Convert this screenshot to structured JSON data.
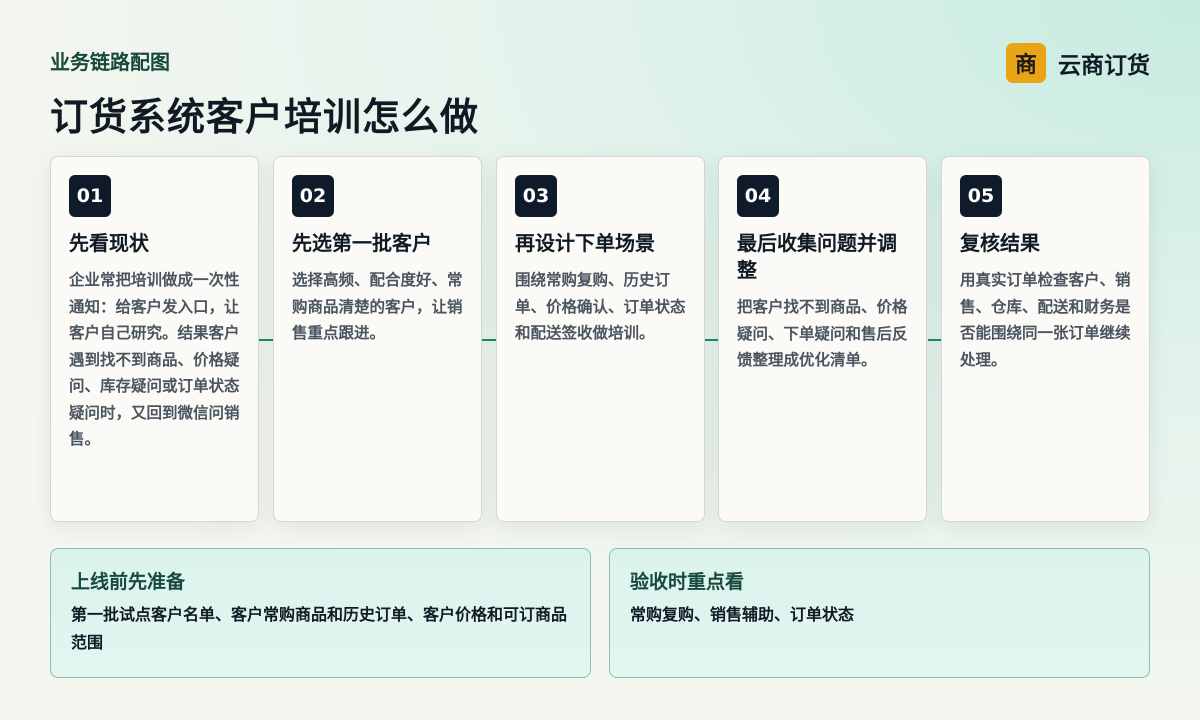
{
  "header": {
    "subtitle": "业务链路配图",
    "title": "订货系统客户培训怎么做"
  },
  "brand": {
    "logo_char": "商",
    "name": "云商订货",
    "logo_color": "#e9a515"
  },
  "steps": [
    {
      "num": "01",
      "title": "先看现状",
      "body": "企业常把培训做成一次性通知：给客户发入口，让客户自己研究。结果客户遇到找不到商品、价格疑问、库存疑问或订单状态疑问时，又回到微信问销售。"
    },
    {
      "num": "02",
      "title": "先选第一批客户",
      "body": "选择高频、配合度好、常购商品清楚的客户，让销售重点跟进。"
    },
    {
      "num": "03",
      "title": "再设计下单场景",
      "body": "围绕常购复购、历史订单、价格确认、订单状态和配送签收做培训。"
    },
    {
      "num": "04",
      "title": "最后收集问题并调整",
      "body": "把客户找不到商品、价格疑问、下单疑问和售后反馈整理成优化清单。"
    },
    {
      "num": "05",
      "title": "复核结果",
      "body": "用真实订单检查客户、销售、仓库、配送和财务是否能围绕同一张订单继续处理。"
    }
  ],
  "panels": [
    {
      "title": "上线前先准备",
      "body": "第一批试点客户名单、客户常购商品和历史订单、客户价格和可订商品范围"
    },
    {
      "title": "验收时重点看",
      "body": "常购复购、销售辅助、订单状态"
    }
  ],
  "colors": {
    "accent": "#1f8a6a",
    "number_badge": "#0f1b2b",
    "panel_border": "#8fbcb0"
  }
}
